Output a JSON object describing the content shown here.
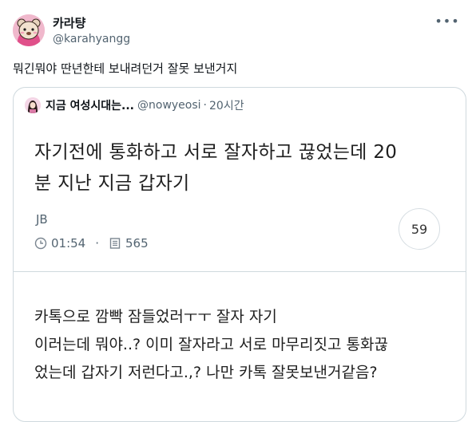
{
  "author": {
    "name": "카라턍",
    "handle": "@karahyangg",
    "avatar_icon": "bear-character-avatar-icon"
  },
  "tweet": {
    "text": "뭐긴뭐야 딴년한테 보내려던거 잘못 보낸거지"
  },
  "more_icon": "more-options-icon",
  "quote": {
    "name": "지금 여성시대는...",
    "handle": "@nowyeosi",
    "dot": "·",
    "time": "20시간",
    "notice": {
      "title_line1": "자기전에 통화하고 서로 잘자하고 끊었는데 20",
      "title_line2": "분 지난 지금 갑자기",
      "author": "JB",
      "time": "01:54",
      "views": "565",
      "comments": "59",
      "time_icon": "clock-icon",
      "views_icon": "document-icon"
    },
    "body_lines": [
      "카톡으로 깜빡 잠들었러ㅜㅜ 잘자 자기",
      "이러는데 뭐야..? 이미 잘자라고 서로 마무리짓고 통화끊",
      "었는데 갑자기 저런다고.,? 나만 카톡 잘못보낸거같음?"
    ]
  },
  "colors": {
    "text_primary": "#0f1419",
    "text_secondary": "#536471",
    "border": "#cfd9de"
  }
}
